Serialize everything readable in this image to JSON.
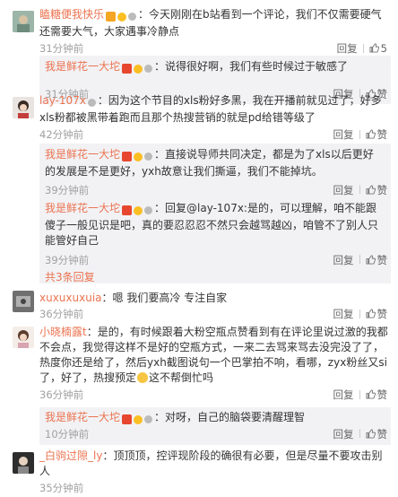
{
  "comments": [
    {
      "username": "瞌糖便我快乐",
      "text": "：今天刚刚在b站看到一个评论，我们不仅需要硬气还需要大气，大家遇事冷静点",
      "time": "31分钟前",
      "reply_label": "回复",
      "like_label": "5",
      "replies": [
        {
          "username": "我是鲜花一大坨",
          "text": "：说得很好啊，我们有些时候过于敏感了",
          "time": "31分钟前",
          "reply_label": "回复",
          "like_label": "赞"
        }
      ]
    },
    {
      "username": "lay-107x",
      "text": "：因为这个节目的xls粉好多黑，我在开播前就见过了，好多xls粉都被黑带着跑而且那个热搜营销的就是pd给错等级了",
      "time": "42分钟前",
      "reply_label": "回复",
      "like_label": "赞",
      "replies": [
        {
          "username": "我是鲜花一大坨",
          "text": "：直接说导师共同决定，都是为了xls以后更好的发展是不是更好，yxh故意让我们撕逼，我们不能掉坑。",
          "time": "39分钟前",
          "reply_label": "回复",
          "like_label": "赞"
        },
        {
          "username": "我是鲜花一大坨",
          "text": "：回复@lay-107x:是的，可以理解，咱不能跟傻子一般见识是吧，真的要忍忍忍不然只会越骂越凶，咱管不了别人只能管好自己",
          "time": "39分钟前",
          "reply_label": "回复",
          "like_label": "赞"
        }
      ],
      "more_replies": "共3条回复"
    },
    {
      "username": "xuxuxuxuia",
      "text": "：嗯 我们要高冷 专注自家",
      "time": "36分钟前",
      "reply_label": "回复",
      "like_label": "赞"
    },
    {
      "username": "小晓楠露t",
      "text": "：是的，有时候跟着大粉空瓶点赞看到有在评论里说过激的我都不会点，我觉得这样不是好的空瓶方式，一来二去骂来骂去没完没了了，热度你还是给了，然后yxh截图说句一个巴掌拍不响，看哪，zyx粉丝又si了，好了，热搜预定",
      "time": "36分钟前",
      "reply_label": "回复",
      "like_label": "赞",
      "replies": [
        {
          "username": "我是鲜花一大坨",
          "text": "：对呀，自己的脑袋要清醒理智",
          "time": "10分钟前",
          "reply_label": "回复",
          "like_label": "赞"
        }
      ]
    },
    {
      "username": "_白驹过隙_ly",
      "text": "：顶顶顶，控评现阶段的确很有必要，但是尽量不要攻击别人",
      "time": "35分钟前",
      "reply_label": "回复",
      "like_label": "赞"
    }
  ],
  "colors": {
    "accent": "#eb7350",
    "reply_bg": "#f2f2f5"
  }
}
